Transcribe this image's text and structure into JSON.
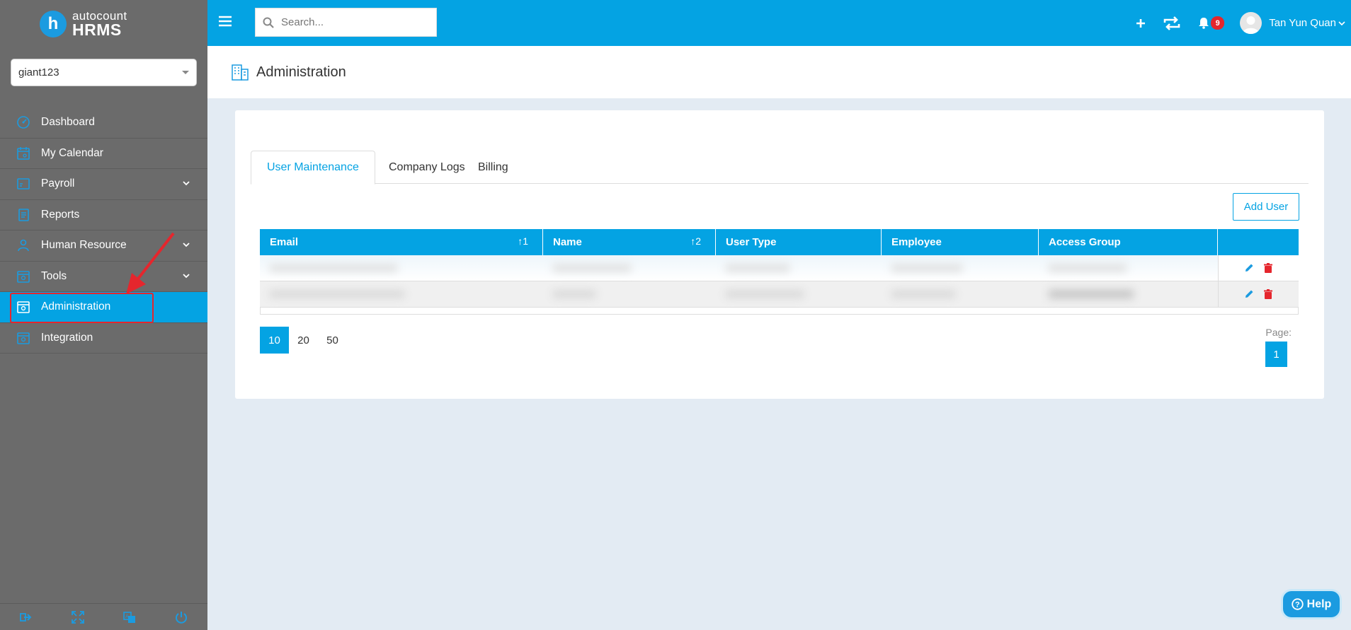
{
  "brand": {
    "logo_letter": "h",
    "line1": "autocount",
    "line2": "HRMS"
  },
  "company_select": {
    "value": "giant123"
  },
  "sidebar": {
    "items": [
      {
        "label": "Dashboard"
      },
      {
        "label": "My Calendar"
      },
      {
        "label": "Payroll"
      },
      {
        "label": "Reports"
      },
      {
        "label": "Human Resource"
      },
      {
        "label": "Tools"
      },
      {
        "label": "Administration"
      },
      {
        "label": "Integration"
      }
    ]
  },
  "topbar": {
    "search_placeholder": "Search...",
    "notification_count": "9",
    "user_name": "Tan Yun Quan"
  },
  "header": {
    "title": "Administration"
  },
  "tabs": [
    {
      "label": "User Maintenance"
    },
    {
      "label": "Company Logs"
    },
    {
      "label": "Billing"
    }
  ],
  "toolbar": {
    "add_user_label": "Add User"
  },
  "table": {
    "columns": [
      {
        "label": "Email",
        "sort": "1"
      },
      {
        "label": "Name",
        "sort": "2"
      },
      {
        "label": "User Type",
        "sort": ""
      },
      {
        "label": "Employee",
        "sort": ""
      },
      {
        "label": "Access Group",
        "sort": ""
      }
    ]
  },
  "pagination": {
    "sizes": [
      "10",
      "20",
      "50"
    ],
    "page_label": "Page:",
    "current_page": "1"
  },
  "help": {
    "label": "Help"
  },
  "colors": {
    "accent": "#04a3e3",
    "sidebar": "#6b6b6b",
    "danger": "#e5262d",
    "background": "#e3ebf3"
  }
}
